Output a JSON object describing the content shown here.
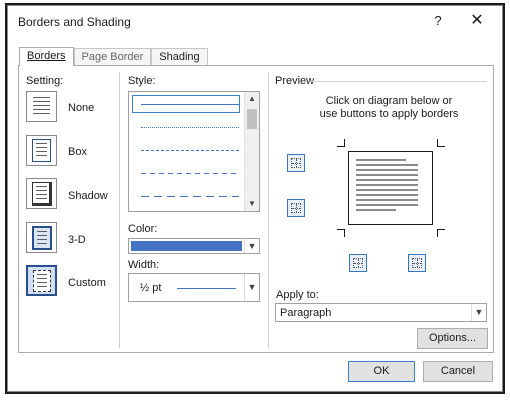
{
  "window": {
    "title": "Borders and Shading",
    "help_glyph": "?",
    "close_glyph": "✕"
  },
  "tabs": [
    {
      "label": "Borders",
      "active": true
    },
    {
      "label": "Page Border",
      "active": false
    },
    {
      "label": "Shading",
      "active": false
    }
  ],
  "setting": {
    "label": "Setting:",
    "items": [
      {
        "label": "None",
        "icon": "setting-none-icon"
      },
      {
        "label": "Box",
        "icon": "setting-box-icon"
      },
      {
        "label": "Shadow",
        "icon": "setting-shadow-icon"
      },
      {
        "label": "3-D",
        "icon": "setting-3d-icon"
      },
      {
        "label": "Custom",
        "icon": "setting-custom-icon",
        "selected": true
      }
    ]
  },
  "style": {
    "label": "Style:",
    "rows": [
      "solid",
      "dotted",
      "dashed-small",
      "dashed",
      "dashed-long"
    ]
  },
  "color": {
    "label": "Color:",
    "value_hex": "#4472c4"
  },
  "width": {
    "label": "Width:",
    "value": "½ pt"
  },
  "preview": {
    "label": "Preview",
    "instruction_line1": "Click on diagram below or",
    "instruction_line2": "use buttons to apply borders"
  },
  "apply_to": {
    "label": "Apply to:",
    "value": "Paragraph"
  },
  "buttons": {
    "options": "Options...",
    "ok": "OK",
    "cancel": "Cancel"
  },
  "colors": {
    "accent": "#3a74c0",
    "color_swatch": "#4472c4"
  }
}
